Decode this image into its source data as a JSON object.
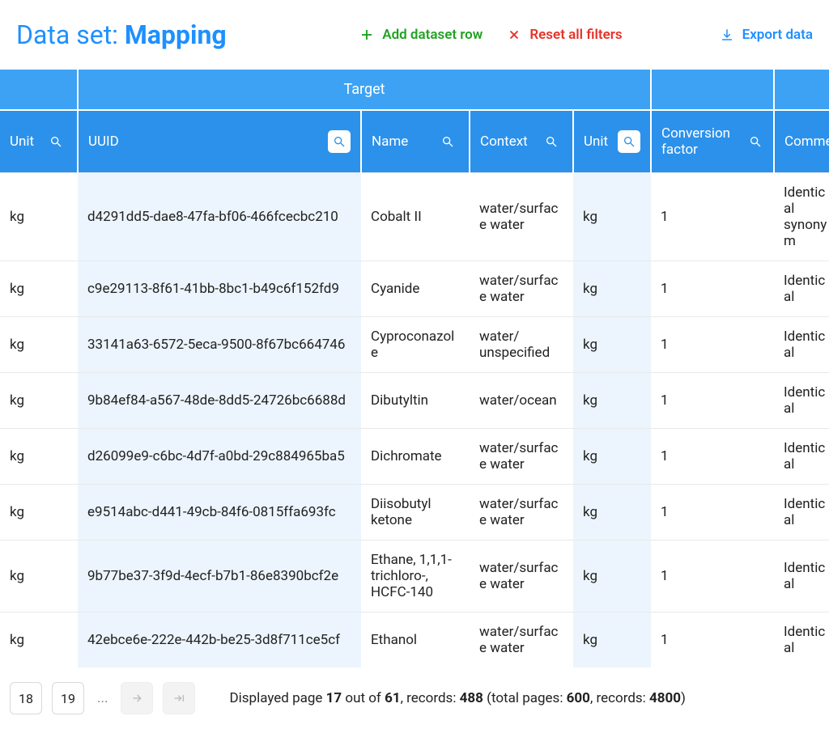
{
  "header": {
    "title_prefix": "Data set: ",
    "title_main": "Mapping",
    "add_label": "Add dataset row",
    "reset_label": "Reset all filters",
    "export_label": "Export data"
  },
  "table": {
    "group_target": "Target",
    "columns": {
      "unit1": "Unit",
      "uuid": "UUID",
      "name": "Name",
      "context": "Context",
      "unit2": "Unit",
      "factor": "Conversion factor",
      "comment": "Comment"
    },
    "rows": [
      {
        "unit1": "kg",
        "uuid": "d4291dd5-dae8-47fa-bf06-466fcecbc210",
        "name": "Cobalt II",
        "context": "water/surface water",
        "unit2": "kg",
        "factor": "1",
        "comment": "Identical synonym"
      },
      {
        "unit1": "kg",
        "uuid": "c9e29113-8f61-41bb-8bc1-b49c6f152fd9",
        "name": "Cyanide",
        "context": "water/surface water",
        "unit2": "kg",
        "factor": "1",
        "comment": "Identical"
      },
      {
        "unit1": "kg",
        "uuid": "33141a63-6572-5eca-9500-8f67bc664746",
        "name": "Cyproconazole",
        "context": "water/ unspecified",
        "unit2": "kg",
        "factor": "1",
        "comment": "Identical"
      },
      {
        "unit1": "kg",
        "uuid": "9b84ef84-a567-48de-8dd5-24726bc6688d",
        "name": "Dibutyltin",
        "context": "water/ocean",
        "unit2": "kg",
        "factor": "1",
        "comment": "Identical"
      },
      {
        "unit1": "kg",
        "uuid": "d26099e9-c6bc-4d7f-a0bd-29c884965ba5",
        "name": "Dichromate",
        "context": "water/surface water",
        "unit2": "kg",
        "factor": "1",
        "comment": "Identical"
      },
      {
        "unit1": "kg",
        "uuid": "e9514abc-d441-49cb-84f6-0815ffa693fc",
        "name": "Diisobutyl ketone",
        "context": "water/surface water",
        "unit2": "kg",
        "factor": "1",
        "comment": "Identical"
      },
      {
        "unit1": "kg",
        "uuid": "9b77be37-3f9d-4ecf-b7b1-86e8390bcf2e",
        "name": "Ethane, 1,1,1-trichloro-, HCFC-140",
        "context": "water/surface water",
        "unit2": "kg",
        "factor": "1",
        "comment": "Identical"
      },
      {
        "unit1": "kg",
        "uuid": "42ebce6e-222e-442b-be25-3d8f711ce5cf",
        "name": "Ethanol",
        "context": "water/surface water",
        "unit2": "kg",
        "factor": "1",
        "comment": "Identical"
      }
    ]
  },
  "footer": {
    "page_a": "18",
    "page_b": "19",
    "summary_1": "Displayed page ",
    "summary_page": "17",
    "summary_2": " out of ",
    "summary_total_pages_disp": "61",
    "summary_3": ", records: ",
    "summary_records_disp": "488",
    "summary_4": " (total pages: ",
    "summary_total_pages": "600",
    "summary_5": ", records: ",
    "summary_records": "4800",
    "summary_6": ")"
  }
}
